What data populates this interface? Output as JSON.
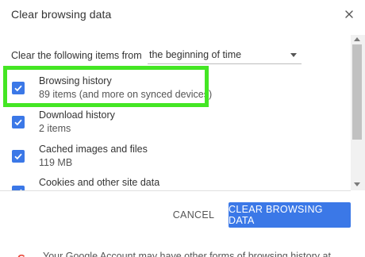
{
  "dialog": {
    "title": "Clear browsing data",
    "close_icon": "close-icon"
  },
  "range": {
    "label": "Clear the following items from",
    "selected": "the beginning of time"
  },
  "items": [
    {
      "title": "Browsing history",
      "subtitle": "89 items (and more on synced devices)",
      "checked": true
    },
    {
      "title": "Download history",
      "subtitle": "2 items",
      "checked": true
    },
    {
      "title": "Cached images and files",
      "subtitle": "119 MB",
      "checked": true
    },
    {
      "title": "Cookies and other site data",
      "subtitle": "",
      "checked": true
    }
  ],
  "buttons": {
    "cancel": "CANCEL",
    "clear": "CLEAR BROWSING DATA"
  },
  "footer": {
    "logo": "G",
    "text": "Your Google Account may have other forms of browsing history at"
  },
  "colors": {
    "accent": "#3b78e7",
    "highlight": "#44e624"
  }
}
